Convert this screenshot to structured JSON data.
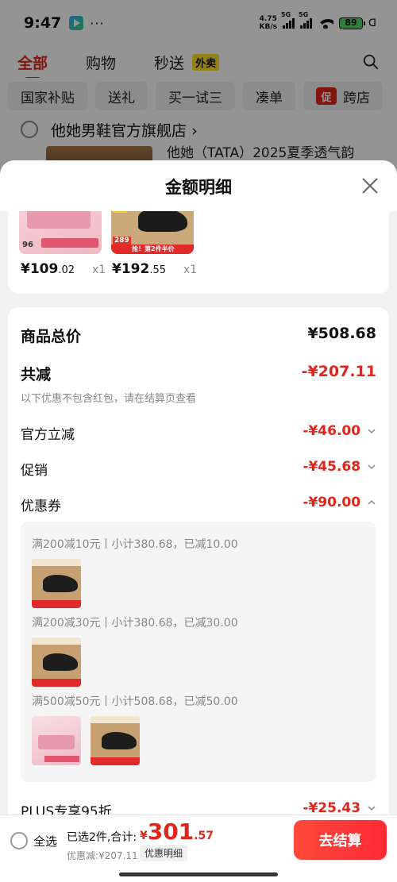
{
  "status_bar": {
    "time": "9:47",
    "dots": "···",
    "net_speed_value": "4.75",
    "net_speed_unit": "KB/s",
    "signal_label": "5G",
    "battery": "89"
  },
  "top_tabs": [
    {
      "label": "全部"
    },
    {
      "label": "购物"
    },
    {
      "label": "秒送"
    }
  ],
  "waimai_badge": "外卖",
  "chips": [
    {
      "label": "国家补贴"
    },
    {
      "label": "送礼"
    },
    {
      "label": "买一试三"
    },
    {
      "label": "凑单"
    },
    {
      "label": "跨店"
    }
  ],
  "promo_badge": "促",
  "shop": {
    "name": "他她男鞋官方旗舰店",
    "chevron": "›",
    "product_title": "他她（TATA）2025夏季透气韵"
  },
  "sheet": {
    "title": "金额明细"
  },
  "products": [
    {
      "price_int": "¥109",
      "price_dec": ".02",
      "qty": "x1",
      "badge_num": "96",
      "icon": "skincare-jar-image"
    },
    {
      "price_int": "¥192",
      "price_dec": ".55",
      "qty": "x1",
      "badge_num": "289",
      "strip_text": "抢！第2件半价",
      "icon": "shoe-image"
    }
  ],
  "details": {
    "goods_total_label": "商品总价",
    "goods_total_value": "¥508.68",
    "total_discount_label": "共减",
    "total_discount_value": "-¥207.11",
    "discount_note": "以下优惠不包含红包，请在结算页查看",
    "official_label": "官方立减",
    "official_value": "-¥46.00",
    "promo_label": "促销",
    "promo_value": "-¥45.68",
    "coupon_label": "优惠券",
    "coupon_value": "-¥90.00",
    "plus_label": "PLUS专享95折",
    "plus_value": "-¥25.43"
  },
  "coupon_rules": [
    {
      "text": "满200减10元丨小计380.68，已减10.00"
    },
    {
      "text": "满200减30元丨小计380.68，已减30.00"
    },
    {
      "text": "满500减50元丨小计508.68，已减50.00"
    }
  ],
  "bottom": {
    "select_all": "全选",
    "selected_count": "已选2件,合计:",
    "total_currency": "¥",
    "total_int": "301",
    "total_dec": ".57",
    "discount_note": "优惠减:¥207.11",
    "discount_detail_btn": "优惠明细",
    "checkout": "去结算"
  },
  "colors": {
    "accent_red": "#e0251b",
    "checkout_red": "#ff2a35",
    "badge_yellow": "#ffde2a",
    "battery_green": "#4cd964"
  }
}
